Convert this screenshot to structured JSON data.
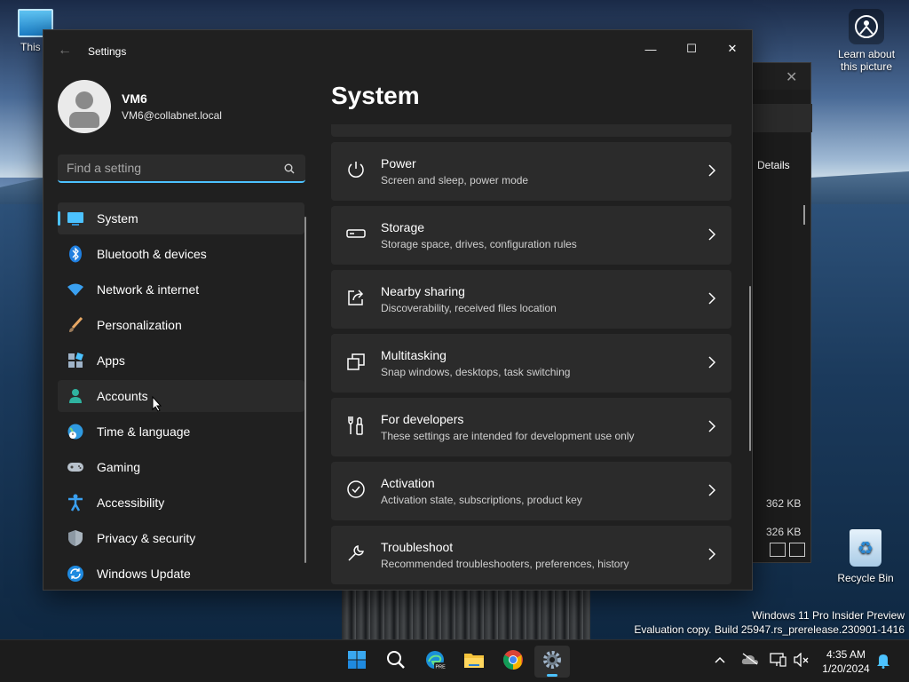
{
  "desktop": {
    "this_pc_label": "This P",
    "learn_label": "Learn about this picture",
    "recycle_label": "Recycle Bin",
    "watermark_line1": "Windows 11 Pro Insider Preview",
    "watermark_line2": "Evaluation copy. Build 25947.rs_prerelease.230901-1416"
  },
  "background_window": {
    "details_label": "Details",
    "size1": "362 KB",
    "size2": "326 KB"
  },
  "window": {
    "title": "Settings",
    "close_glyph": "✕",
    "min_glyph": "—",
    "max_glyph": "☐"
  },
  "profile": {
    "name": "VM6",
    "email": "VM6@collabnet.local"
  },
  "search": {
    "placeholder": "Find a setting"
  },
  "nav": {
    "items": [
      {
        "label": "System"
      },
      {
        "label": "Bluetooth & devices"
      },
      {
        "label": "Network & internet"
      },
      {
        "label": "Personalization"
      },
      {
        "label": "Apps"
      },
      {
        "label": "Accounts"
      },
      {
        "label": "Time & language"
      },
      {
        "label": "Gaming"
      },
      {
        "label": "Accessibility"
      },
      {
        "label": "Privacy & security"
      },
      {
        "label": "Windows Update"
      }
    ]
  },
  "main": {
    "title": "System",
    "cards": [
      {
        "title": "Power",
        "desc": "Screen and sleep, power mode",
        "icon": "power-icon"
      },
      {
        "title": "Storage",
        "desc": "Storage space, drives, configuration rules",
        "icon": "storage-icon"
      },
      {
        "title": "Nearby sharing",
        "desc": "Discoverability, received files location",
        "icon": "share-icon"
      },
      {
        "title": "Multitasking",
        "desc": "Snap windows, desktops, task switching",
        "icon": "multitasking-icon"
      },
      {
        "title": "For developers",
        "desc": "These settings are intended for development use only",
        "icon": "developer-icon"
      },
      {
        "title": "Activation",
        "desc": "Activation state, subscriptions, product key",
        "icon": "activation-icon"
      },
      {
        "title": "Troubleshoot",
        "desc": "Recommended troubleshooters, preferences, history",
        "icon": "wrench-icon"
      }
    ]
  },
  "taskbar": {
    "time": "4:35 AM",
    "date": "1/20/2024",
    "apps": [
      "start-icon",
      "search-icon",
      "edge-icon",
      "file-explorer-icon",
      "chrome-icon",
      "settings-icon"
    ]
  },
  "colors": {
    "accent": "#4cc2ff",
    "window_bg": "#202020",
    "card_bg": "#2b2b2b"
  }
}
